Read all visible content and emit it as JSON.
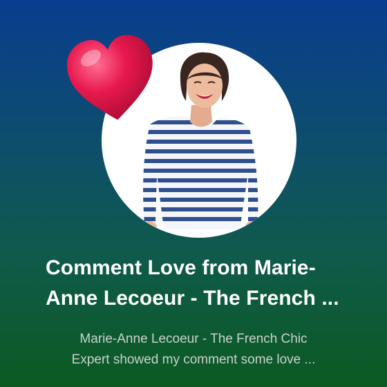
{
  "notification": {
    "title_line1": "Comment Love from Marie-",
    "title_line2": "Anne Lecoeur - The French ...",
    "subtitle_line1": "Marie-Anne Lecoeur - The French Chic",
    "subtitle_line2": "Expert showed my comment some love ..."
  },
  "icons": {
    "heart": "heart-icon"
  },
  "colors": {
    "background_top": "#0a3d8f",
    "background_bottom": "#0c5a22",
    "heart": "#e8194f",
    "title_text": "#ffffff",
    "subtitle_text": "#c9d2cc"
  }
}
